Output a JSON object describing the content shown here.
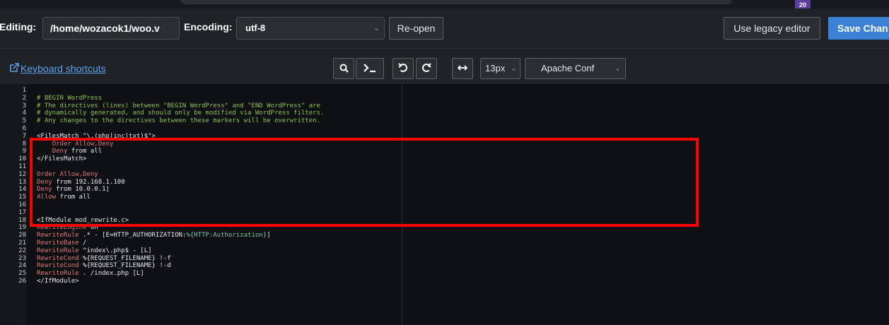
{
  "topbar": {
    "badge": "20"
  },
  "toolbar": {
    "editing_label": "Editing:",
    "file_path": "/home/wozacok1/woo.v",
    "encoding_label": "Encoding:",
    "encoding_value": "utf-8",
    "reopen_label": "Re-open",
    "legacy_label": "Use legacy editor",
    "save_label": "Save Chan"
  },
  "toolbar2": {
    "keyboard_shortcuts": "Keyboard shortcuts",
    "font_size": "13px",
    "mode": "Apache Conf"
  },
  "editor": {
    "lines": [
      {
        "n": "1",
        "parts": []
      },
      {
        "n": "2",
        "parts": [
          {
            "c": "comment",
            "t": "# BEGIN WordPress"
          }
        ]
      },
      {
        "n": "3",
        "parts": [
          {
            "c": "comment",
            "t": "# The directives (lines) between \"BEGIN WordPress\" and \"END WordPress\" are"
          }
        ]
      },
      {
        "n": "4",
        "parts": [
          {
            "c": "comment",
            "t": "# dynamically generated, and should only be modified via WordPress filters."
          }
        ]
      },
      {
        "n": "5",
        "parts": [
          {
            "c": "comment",
            "t": "# Any changes to the directives between these markers will be overwritten."
          }
        ]
      },
      {
        "n": "6",
        "parts": []
      },
      {
        "n": "7",
        "parts": [
          {
            "c": "tag",
            "t": "<FilesMatch \"\\.(php|inc|txt)$\">"
          }
        ]
      },
      {
        "n": "8",
        "parts": [
          {
            "c": "text",
            "t": "    "
          },
          {
            "c": "dir",
            "t": "Order Allow,Deny"
          }
        ]
      },
      {
        "n": "9",
        "parts": [
          {
            "c": "text",
            "t": "    "
          },
          {
            "c": "dir",
            "t": "Deny"
          },
          {
            "c": "text",
            "t": " from all"
          }
        ]
      },
      {
        "n": "10",
        "parts": [
          {
            "c": "tag",
            "t": "</FilesMatch>"
          }
        ]
      },
      {
        "n": "11",
        "parts": []
      },
      {
        "n": "12",
        "parts": [
          {
            "c": "dir",
            "t": "Order Allow,Deny"
          }
        ]
      },
      {
        "n": "13",
        "parts": [
          {
            "c": "dir",
            "t": "Deny"
          },
          {
            "c": "text",
            "t": " from 192.168.1.100"
          }
        ]
      },
      {
        "n": "14",
        "parts": [
          {
            "c": "dir",
            "t": "Deny"
          },
          {
            "c": "text",
            "t": " from 10.0.0.1|"
          }
        ]
      },
      {
        "n": "15",
        "parts": [
          {
            "c": "dir",
            "t": "Allow"
          },
          {
            "c": "text",
            "t": " from all"
          }
        ]
      },
      {
        "n": "16",
        "parts": []
      },
      {
        "n": "17",
        "parts": []
      },
      {
        "n": "18",
        "parts": [
          {
            "c": "tag",
            "t": "<IfModule mod_rewrite.c>"
          }
        ]
      },
      {
        "n": "19",
        "parts": [
          {
            "c": "dir",
            "t": "RewriteEngine"
          },
          {
            "c": "text",
            "t": " On"
          }
        ]
      },
      {
        "n": "20",
        "parts": [
          {
            "c": "dir",
            "t": "RewriteRule"
          },
          {
            "c": "text",
            "t": " .* - [E=HTTP_AUTHORIZATION:"
          },
          {
            "c": "var",
            "t": "%{HTTP:Authorization}"
          },
          {
            "c": "text",
            "t": "]"
          }
        ]
      },
      {
        "n": "21",
        "parts": [
          {
            "c": "dir",
            "t": "RewriteBase"
          },
          {
            "c": "text",
            "t": " /"
          }
        ]
      },
      {
        "n": "22",
        "parts": [
          {
            "c": "dir",
            "t": "RewriteRule"
          },
          {
            "c": "text",
            "t": " ^index\\.php$ - [L]"
          }
        ]
      },
      {
        "n": "23",
        "parts": [
          {
            "c": "dir",
            "t": "RewriteCond"
          },
          {
            "c": "text",
            "t": " %{REQUEST_FILENAME} !-f"
          }
        ]
      },
      {
        "n": "24",
        "parts": [
          {
            "c": "dir",
            "t": "RewriteCond"
          },
          {
            "c": "text",
            "t": " %{REQUEST_FILENAME} !-d"
          }
        ]
      },
      {
        "n": "25",
        "parts": [
          {
            "c": "dir",
            "t": "RewriteRule"
          },
          {
            "c": "text",
            "t": " . /index.php [L]"
          }
        ]
      },
      {
        "n": "26",
        "parts": [
          {
            "c": "tag",
            "t": "</IfModule>"
          }
        ]
      }
    ]
  },
  "colors": {
    "accent": "#3b82d6",
    "highlight": "#ff0000",
    "comment": "#8bc34a",
    "directive": "#e07878"
  }
}
